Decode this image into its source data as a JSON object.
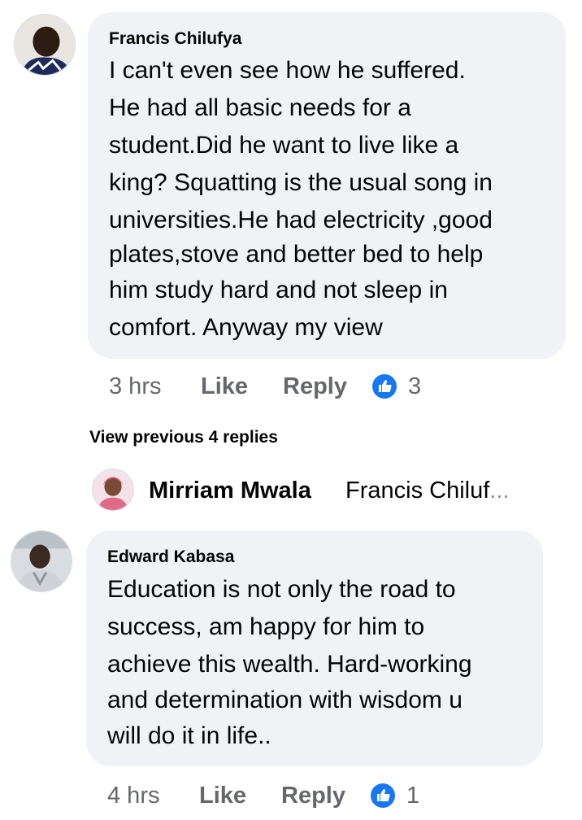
{
  "comments": [
    {
      "author": "Francis Chilufya",
      "lines": [
        "I can't even see how he suffered.",
        "He had all basic needs for a",
        "student.Did he want to live like a",
        "king? Squatting is the usual song in",
        "universities.He had electricity ,good",
        "plates,stove and better bed to help",
        "him study hard and not sleep in",
        "comfort. Anyway my view"
      ],
      "time": "3 hrs",
      "like_label": "Like",
      "reply_label": "Reply",
      "reaction_icon": "thumbs-up-icon",
      "reaction_count": "3"
    },
    {
      "author": "Edward Kabasa",
      "lines": [
        "Education is not only the road to",
        "success, am happy for him to",
        "achieve this wealth. Hard-working",
        "and determination with wisdom u",
        "will do it in life.."
      ],
      "time": "4 hrs",
      "like_label": "Like",
      "reply_label": "Reply",
      "reaction_icon": "thumbs-up-icon",
      "reaction_count": "1"
    }
  ],
  "thread": {
    "view_previous": "View previous 4 replies",
    "latest_reply": {
      "author": "Mirriam Mwala",
      "preview": "Francis Chiluf",
      "ellipsis": "..."
    }
  },
  "colors": {
    "bubble": "#f0f2f5",
    "secondary_text": "#65676b",
    "like_blue": "#1877f2",
    "text": "#050505"
  }
}
